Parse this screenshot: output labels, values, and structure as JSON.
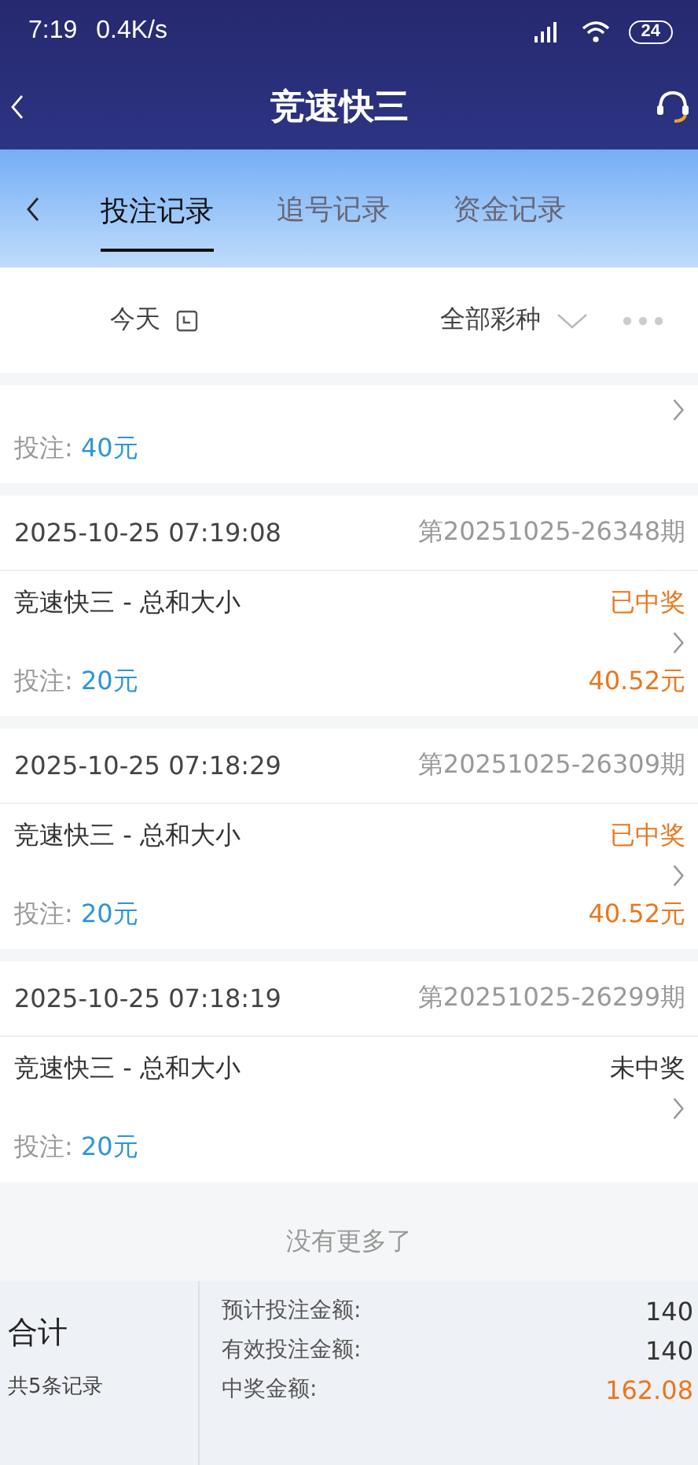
{
  "status_bar": {
    "time": "7:19",
    "speed": "0.4K/s",
    "battery": "24"
  },
  "header": {
    "title": "竞速快三"
  },
  "tabs": [
    {
      "label": "投注记录",
      "selected": true
    },
    {
      "label": "追号记录",
      "selected": false
    },
    {
      "label": "资金记录",
      "selected": false
    }
  ],
  "filters": {
    "date": "今天",
    "lottery": "全部彩种"
  },
  "records": [
    {
      "stake_label": "投注:",
      "stake": "40元"
    },
    {
      "time": "2025-10-25 07:19:08",
      "issue": "第20251025-26348期",
      "game": "竞速快三 - 总和大小",
      "result": "已中奖",
      "won": true,
      "stake_label": "投注:",
      "stake": "20元",
      "prize": "40.52元"
    },
    {
      "time": "2025-10-25 07:18:29",
      "issue": "第20251025-26309期",
      "game": "竞速快三 - 总和大小",
      "result": "已中奖",
      "won": true,
      "stake_label": "投注:",
      "stake": "20元",
      "prize": "40.52元"
    },
    {
      "time": "2025-10-25 07:18:19",
      "issue": "第20251025-26299期",
      "game": "竞速快三 - 总和大小",
      "result": "未中奖",
      "won": false,
      "stake_label": "投注:",
      "stake": "20元"
    }
  ],
  "end_note": "没有更多了",
  "summary": {
    "title": "合计",
    "count": "共5条记录",
    "rows": [
      {
        "label": "预计投注金额:",
        "value": "140",
        "highlight": false
      },
      {
        "label": "有效投注金额:",
        "value": "140",
        "highlight": false
      },
      {
        "label": "中奖金额:",
        "value": "162.08",
        "highlight": true
      }
    ]
  }
}
